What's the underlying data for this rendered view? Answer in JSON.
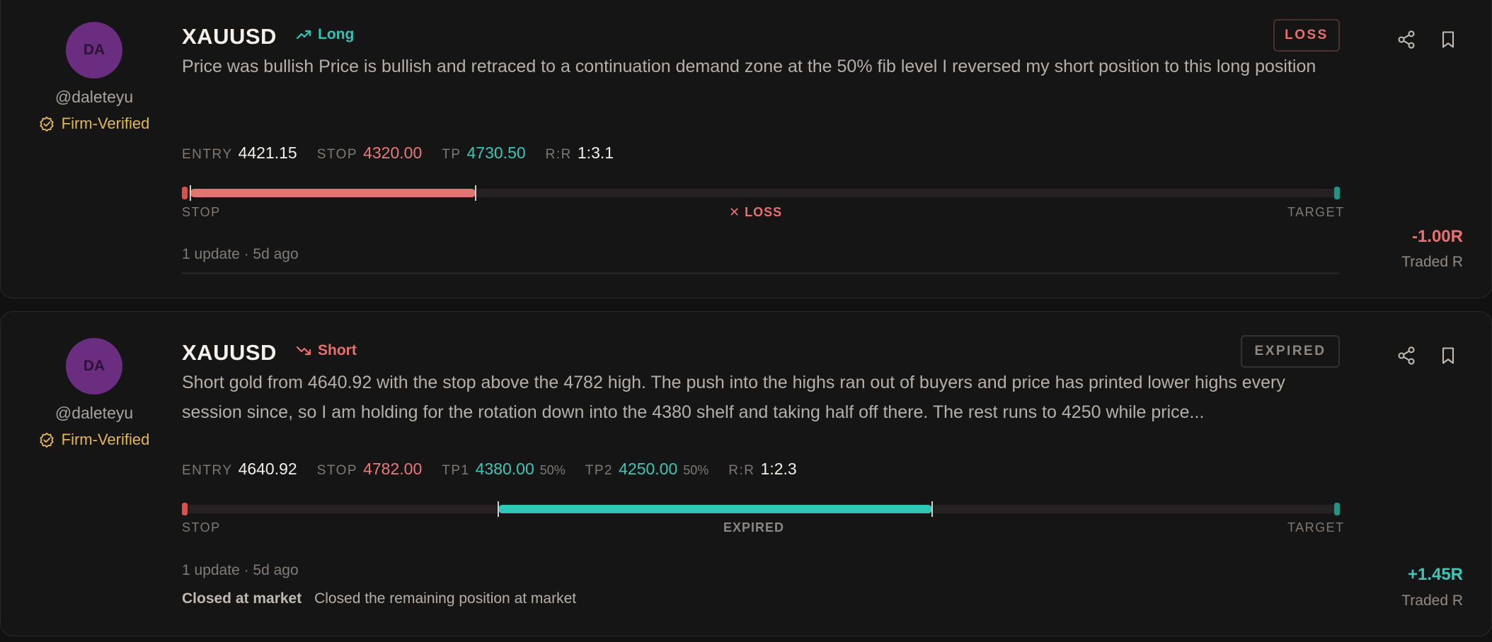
{
  "trades": [
    {
      "avatar_initials": "DA",
      "handle": "@daleteyu",
      "verified_label": "Firm-Verified",
      "symbol": "XAUUSD",
      "direction": "Long",
      "status": "LOSS",
      "description": "Price was bullish Price is bullish and retraced to a continuation demand zone at the 50% fib level I reversed my short position to this long position",
      "entry_label": "ENTRY",
      "entry": "4421.15",
      "stop_label": "STOP",
      "stop": "4320.00",
      "tp_label": "TP",
      "tp": "4730.50",
      "rr_label": "R:R",
      "rr": "1:3.1",
      "progress": {
        "fill_start_fraction": 0,
        "fill_end_fraction": 0.25,
        "stop_label": "STOP",
        "target_label": "TARGET",
        "center_label": "✕ LOSS"
      },
      "updates": "1 update",
      "time_ago": "· 5d ago",
      "result_r": "-1.00R",
      "result_label": "Traded R"
    },
    {
      "avatar_initials": "DA",
      "handle": "@daleteyu",
      "verified_label": "Firm-Verified",
      "symbol": "XAUUSD",
      "direction": "Short",
      "status": "EXPIRED",
      "description": "Short gold from 4640.92 with the stop above the 4782 high. The push into the highs ran out of buyers and price has printed lower highs every session since, so I am holding for the rotation down into the 4380 shelf and taking half off there. The rest runs to 4250 while price...",
      "entry_label": "ENTRY",
      "entry": "4640.92",
      "stop_label": "STOP",
      "stop": "4782.00",
      "tp1_label": "TP1",
      "tp1": "4380.00",
      "tp1_pct": "50%",
      "tp2_label": "TP2",
      "tp2": "4250.00",
      "tp2_pct": "50%",
      "rr_label": "R:R",
      "rr": "1:2.3",
      "progress": {
        "fill_start_fraction": 0.27,
        "fill_end_fraction": 0.65,
        "stop_label": "STOP",
        "target_label": "TARGET",
        "center_label": "EXPIRED"
      },
      "updates": "1 update",
      "time_ago": "· 5d ago",
      "closed_title": "Closed at market",
      "closed_note": "Closed the remaining position at market",
      "result_r": "+1.45R",
      "result_label": "Traded R"
    }
  ],
  "icons": {
    "share": "share-icon",
    "bookmark": "bookmark-icon",
    "verified": "verified-badge-icon",
    "trend_up": "trend-up-icon",
    "trend_down": "trend-down-icon"
  },
  "colors": {
    "teal": "#2ec7b8",
    "red": "#e27471",
    "gold": "#e4b64e",
    "avatar": "#6a2d80"
  }
}
